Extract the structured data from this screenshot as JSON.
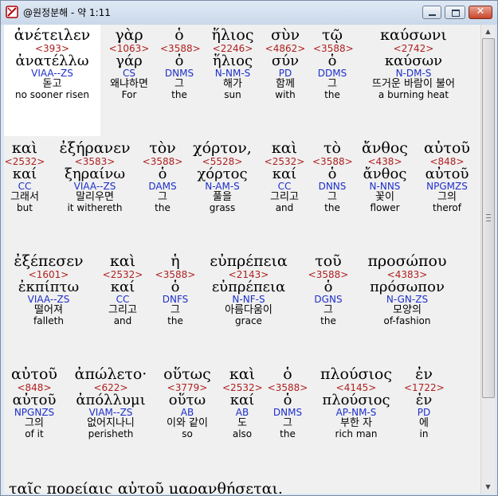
{
  "window": {
    "title": "@원정분해 - 약 1:11"
  },
  "icons": {
    "app": "app-icon",
    "minimize": "minimize-icon",
    "maximize": "maximize-icon",
    "close": "close-icon"
  },
  "colors": {
    "code": "#b02020",
    "parse": "#1d2fc9"
  },
  "rows": [
    {
      "units": [
        {
          "greek": "ἀνέτειλεν",
          "code": "<393>",
          "lemma": "ἀνατέλλω",
          "parse": "VIAA--ZS",
          "korean": "돋고",
          "english": "no sooner risen"
        },
        {
          "greek": "γὰρ",
          "code": "<1063>",
          "lemma": "γάρ",
          "parse": "CS",
          "korean": "왜냐하면",
          "english": "For"
        },
        {
          "greek": "ὁ",
          "code": "<3588>",
          "lemma": "ὁ",
          "parse": "DNMS",
          "korean": "그",
          "english": "the"
        },
        {
          "greek": "ἥλιος",
          "code": "<2246>",
          "lemma": "ἥλιος",
          "parse": "N-NM-S",
          "korean": "해가",
          "english": "sun"
        },
        {
          "greek": "σὺν",
          "code": "<4862>",
          "lemma": "σύν",
          "parse": "PD",
          "korean": "함께",
          "english": "with"
        },
        {
          "greek": "τῷ",
          "code": "<3588>",
          "lemma": "ὁ",
          "parse": "DDMS",
          "korean": "그",
          "english": "the"
        },
        {
          "greek": "καύσωνι",
          "code": "<2742>",
          "lemma": "καύσων",
          "parse": "N-DM-S",
          "korean": "뜨거운 바람이 불어",
          "english": "a burning heat"
        }
      ]
    },
    {
      "units": [
        {
          "greek": "καὶ",
          "code": "<2532>",
          "lemma": "καί",
          "parse": "CC",
          "korean": "그래서",
          "english": "but"
        },
        {
          "greek": "ἐξήρανεν",
          "code": "<3583>",
          "lemma": "ξηραίνω",
          "parse": "VIAA--ZS",
          "korean": "말리우면",
          "english": "it withereth"
        },
        {
          "greek": "τὸν",
          "code": "<3588>",
          "lemma": "ὁ",
          "parse": "DAMS",
          "korean": "그",
          "english": "the"
        },
        {
          "greek": "χόρτον,",
          "code": "<5528>",
          "lemma": "χόρτος",
          "parse": "N-AM-S",
          "korean": "풀을",
          "english": "grass"
        },
        {
          "greek": "καὶ",
          "code": "<2532>",
          "lemma": "καί",
          "parse": "CC",
          "korean": "그리고",
          "english": "and"
        },
        {
          "greek": "τὸ",
          "code": "<3588>",
          "lemma": "ὁ",
          "parse": "DNNS",
          "korean": "그",
          "english": "the"
        },
        {
          "greek": "ἄνθος",
          "code": "<438>",
          "lemma": "ἄνθος",
          "parse": "N-NNS",
          "korean": "꽃이",
          "english": "flower"
        },
        {
          "greek": "αὐτοῦ",
          "code": "<848>",
          "lemma": "αὐτοῦ",
          "parse": "NPGMZS",
          "korean": "그의",
          "english": "therof"
        }
      ]
    },
    {
      "units": [
        {
          "greek": "ἐξέπεσεν",
          "code": "<1601>",
          "lemma": "ἐκπίπτω",
          "parse": "VIAA--ZS",
          "korean": "떨어져",
          "english": "falleth"
        },
        {
          "greek": "καὶ",
          "code": "<2532>",
          "lemma": "καί",
          "parse": "CC",
          "korean": "그리고",
          "english": "and"
        },
        {
          "greek": "ἡ",
          "code": "<3588>",
          "lemma": "ὁ",
          "parse": "DNFS",
          "korean": "그",
          "english": "the"
        },
        {
          "greek": "εὐπρέπεια",
          "code": "<2143>",
          "lemma": "εὐπρέπεια",
          "parse": "N-NF-S",
          "korean": "아름다움이",
          "english": "grace"
        },
        {
          "greek": "τοῦ",
          "code": "<3588>",
          "lemma": "ὁ",
          "parse": "DGNS",
          "korean": "그",
          "english": "the"
        },
        {
          "greek": "προσώπου",
          "code": "<4383>",
          "lemma": "πρόσωπον",
          "parse": "N-GN-ZS",
          "korean": "모양의",
          "english": "of-fashion"
        }
      ]
    },
    {
      "units": [
        {
          "greek": "αὐτοῦ",
          "code": "<848>",
          "lemma": "αὐτοῦ",
          "parse": "NPGNZS",
          "korean": "그의",
          "english": "of it"
        },
        {
          "greek": "ἀπώλετο·",
          "code": "<622>",
          "lemma": "ἀπόλλυμι",
          "parse": "VIAM--ZS",
          "korean": "없어지나니",
          "english": "perisheth"
        },
        {
          "greek": "οὕτως",
          "code": "<3779>",
          "lemma": "οὕτω",
          "parse": "AB",
          "korean": "이와 같이",
          "english": "so"
        },
        {
          "greek": "καὶ",
          "code": "<2532>",
          "lemma": "καί",
          "parse": "AB",
          "korean": "도",
          "english": "also"
        },
        {
          "greek": "ὁ",
          "code": "<3588>",
          "lemma": "ὁ",
          "parse": "DNMS",
          "korean": "그",
          "english": "the"
        },
        {
          "greek": "πλούσιος",
          "code": "<4145>",
          "lemma": "πλούσιος",
          "parse": "AP-NM-S",
          "korean": "부한 자",
          "english": "rich man"
        },
        {
          "greek": "ἐν",
          "code": "<1722>",
          "lemma": "ἐν",
          "parse": "PD",
          "korean": "에",
          "english": "in"
        }
      ]
    }
  ],
  "partial_line": "ταῖς πορείαις αὐτοῦ μαρανθήσεται."
}
